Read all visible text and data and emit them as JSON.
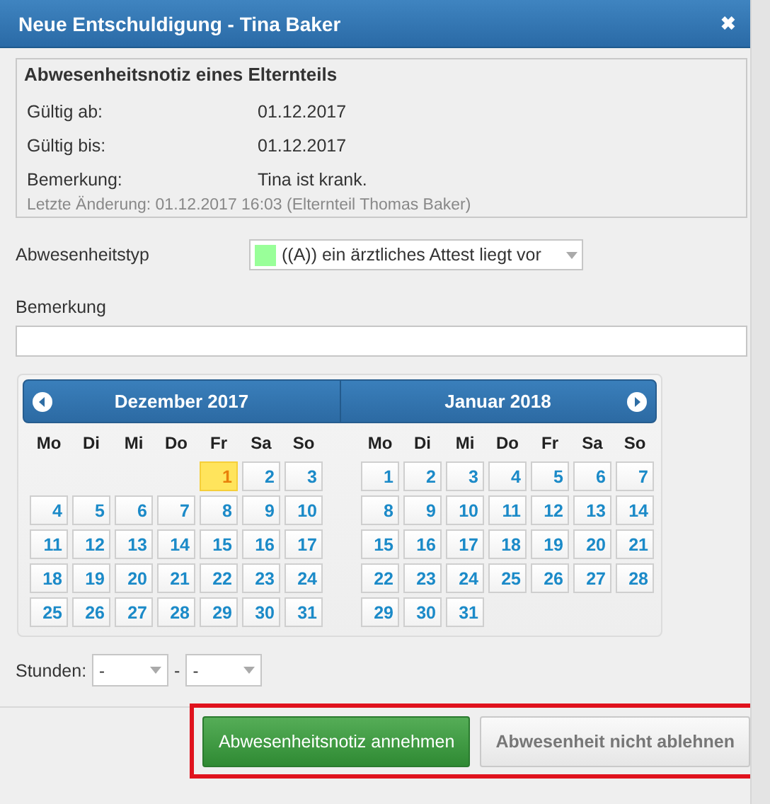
{
  "window": {
    "title": "Neue Entschuldigung - Tina Baker",
    "close": "✖"
  },
  "notice": {
    "heading": "Abwesenheitsnotiz eines Elternteils",
    "fields": [
      {
        "label": "Gültig ab:",
        "value": "01.12.2017"
      },
      {
        "label": "Gültig bis:",
        "value": "01.12.2017"
      },
      {
        "label": "Bemerkung:",
        "value": "Tina ist krank."
      }
    ],
    "last_change": "Letzte Änderung: 01.12.2017 16:03 (Elternteil Thomas Baker)"
  },
  "absence_type": {
    "label": "Abwesenheitstyp",
    "value": "((A)) ein ärztliches Attest liegt vor",
    "color": "#99ff99"
  },
  "remark": {
    "label": "Bemerkung"
  },
  "calendar": {
    "months": [
      {
        "title": "Dezember 2017",
        "weekdays": [
          "Mo",
          "Di",
          "Mi",
          "Do",
          "Fr",
          "Sa",
          "So"
        ],
        "weeks": [
          [
            {
              "day": "1",
              "selected": true
            },
            {
              "day": "2",
              "selected": false
            },
            {
              "day": "3",
              "selected": false
            }
          ],
          [
            {
              "day": "4",
              "selected": false
            },
            {
              "day": "5",
              "selected": false
            },
            {
              "day": "6",
              "selected": false
            },
            {
              "day": "7",
              "selected": false
            },
            {
              "day": "8",
              "selected": false
            },
            {
              "day": "9",
              "selected": false
            },
            {
              "day": "10",
              "selected": false
            }
          ],
          [
            {
              "day": "11",
              "selected": false
            },
            {
              "day": "12",
              "selected": false
            },
            {
              "day": "13",
              "selected": false
            },
            {
              "day": "14",
              "selected": false
            },
            {
              "day": "15",
              "selected": false
            },
            {
              "day": "16",
              "selected": false
            },
            {
              "day": "17",
              "selected": false
            }
          ],
          [
            {
              "day": "18",
              "selected": false
            },
            {
              "day": "19",
              "selected": false
            },
            {
              "day": "20",
              "selected": false
            },
            {
              "day": "21",
              "selected": false
            },
            {
              "day": "22",
              "selected": false
            },
            {
              "day": "23",
              "selected": false
            },
            {
              "day": "24",
              "selected": false
            }
          ],
          [
            {
              "day": "25",
              "selected": false
            },
            {
              "day": "26",
              "selected": false
            },
            {
              "day": "27",
              "selected": false
            },
            {
              "day": "28",
              "selected": false
            },
            {
              "day": "29",
              "selected": false
            },
            {
              "day": "30",
              "selected": false
            },
            {
              "day": "31",
              "selected": false
            }
          ]
        ]
      },
      {
        "title": "Januar 2018",
        "weekdays": [
          "Mo",
          "Di",
          "Mi",
          "Do",
          "Fr",
          "Sa",
          "So"
        ],
        "weeks": [
          [
            {
              "day": "1",
              "selected": false
            },
            {
              "day": "2",
              "selected": false
            },
            {
              "day": "3",
              "selected": false
            },
            {
              "day": "4",
              "selected": false
            },
            {
              "day": "5",
              "selected": false
            },
            {
              "day": "6",
              "selected": false
            },
            {
              "day": "7",
              "selected": false
            }
          ],
          [
            {
              "day": "8",
              "selected": false
            },
            {
              "day": "9",
              "selected": false
            },
            {
              "day": "10",
              "selected": false
            },
            {
              "day": "11",
              "selected": false
            },
            {
              "day": "12",
              "selected": false
            },
            {
              "day": "13",
              "selected": false
            },
            {
              "day": "14",
              "selected": false
            }
          ],
          [
            {
              "day": "15",
              "selected": false
            },
            {
              "day": "16",
              "selected": false
            },
            {
              "day": "17",
              "selected": false
            },
            {
              "day": "18",
              "selected": false
            },
            {
              "day": "19",
              "selected": false
            },
            {
              "day": "20",
              "selected": false
            },
            {
              "day": "21",
              "selected": false
            }
          ],
          [
            {
              "day": "22",
              "selected": false
            },
            {
              "day": "23",
              "selected": false
            },
            {
              "day": "24",
              "selected": false
            },
            {
              "day": "25",
              "selected": false
            },
            {
              "day": "26",
              "selected": false
            },
            {
              "day": "27",
              "selected": false
            },
            {
              "day": "28",
              "selected": false
            }
          ],
          [
            {
              "day": "29",
              "selected": false
            },
            {
              "day": "30",
              "selected": false
            },
            {
              "day": "31",
              "selected": false
            }
          ]
        ]
      }
    ]
  },
  "hours": {
    "label": "Stunden:",
    "from": "-",
    "separator": "-",
    "to": "-"
  },
  "footer": {
    "highlighted": true,
    "buttons": [
      {
        "label": "Abwesenheitsnotiz annehmen",
        "kind": "primary"
      },
      {
        "label": "Abwesenheit nicht ablehnen",
        "kind": "secondary"
      }
    ]
  }
}
